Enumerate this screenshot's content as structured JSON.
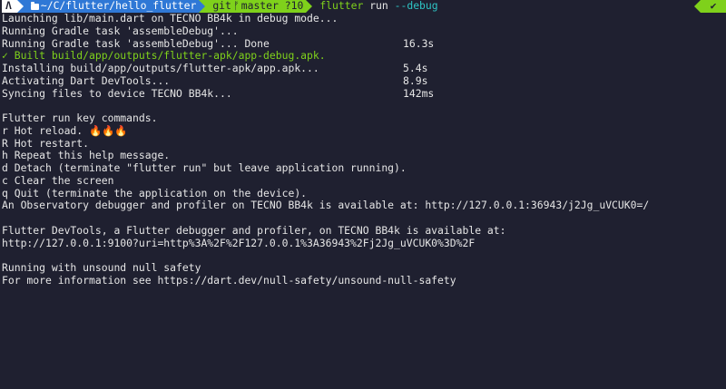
{
  "prompt": {
    "os_icon": "Λ",
    "dir_prefix": "~",
    "dir_path": "/C/flutter/hello_flutter",
    "git_label": "git",
    "branch_icon": "ᚠ",
    "branch": "master ?10",
    "command": "flutter",
    "command_arg": "run",
    "command_flag": "--debug",
    "status_ok": "✔"
  },
  "lines": [
    {
      "text": "Launching lib/main.dart on TECNO BB4k in debug mode...",
      "time": ""
    },
    {
      "text": "Running Gradle task 'assembleDebug'...",
      "time": ""
    },
    {
      "text": "Running Gradle task 'assembleDebug'... Done",
      "time": "16.3s"
    },
    {
      "text": "✓ Built build/app/outputs/flutter-apk/app-debug.apk.",
      "time": "",
      "color": "green"
    },
    {
      "text": "Installing build/app/outputs/flutter-apk/app.apk...",
      "time": "5.4s"
    },
    {
      "text": "Activating Dart DevTools...",
      "time": "8.9s"
    },
    {
      "text": "Syncing files to device TECNO BB4k...",
      "time": "142ms"
    },
    {
      "text": "",
      "time": ""
    },
    {
      "text": "Flutter run key commands.",
      "time": ""
    },
    {
      "text": "r Hot reload. 🔥🔥🔥",
      "time": ""
    },
    {
      "text": "R Hot restart.",
      "time": ""
    },
    {
      "text": "h Repeat this help message.",
      "time": ""
    },
    {
      "text": "d Detach (terminate \"flutter run\" but leave application running).",
      "time": ""
    },
    {
      "text": "c Clear the screen",
      "time": ""
    },
    {
      "text": "q Quit (terminate the application on the device).",
      "time": ""
    },
    {
      "text": "An Observatory debugger and profiler on TECNO BB4k is available at: http://127.0.0.1:36943/j2Jg_uVCUK0=/",
      "time": ""
    },
    {
      "text": "",
      "time": ""
    },
    {
      "text": "Flutter DevTools, a Flutter debugger and profiler, on TECNO BB4k is available at:",
      "time": ""
    },
    {
      "text": "http://127.0.0.1:9100?uri=http%3A%2F%2F127.0.0.1%3A36943%2Fj2Jg_uVCUK0%3D%2F",
      "time": ""
    },
    {
      "text": "",
      "time": ""
    },
    {
      "text": "Running with unsound null safety",
      "time": ""
    },
    {
      "text": "For more information see https://dart.dev/null-safety/unsound-null-safety",
      "time": ""
    }
  ],
  "colors": {
    "background": "#1f2030",
    "foreground": "#e6e6e6",
    "accent_green": "#7fd11b",
    "accent_blue": "#2f78d6",
    "accent_cyan": "#2ec4c4"
  }
}
